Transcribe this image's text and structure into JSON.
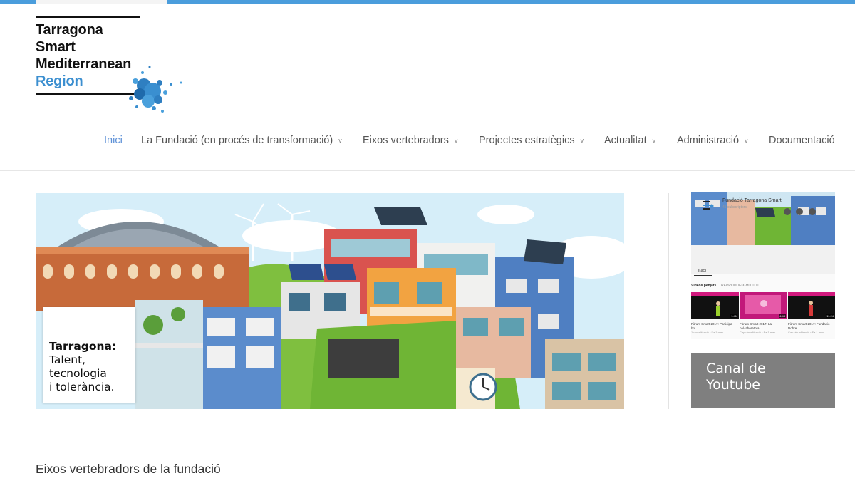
{
  "logo": {
    "lines": [
      "Tarragona",
      "Smart",
      "Mediterranean",
      "Region"
    ]
  },
  "nav": {
    "items": [
      {
        "label": "Inici",
        "active": true,
        "dropdown": false
      },
      {
        "label": "La Fundació (en procés de transformació)",
        "active": false,
        "dropdown": true
      },
      {
        "label": "Eixos vertebradors",
        "active": false,
        "dropdown": true
      },
      {
        "label": "Projectes estratègics",
        "active": false,
        "dropdown": true
      },
      {
        "label": "Actualitat",
        "active": false,
        "dropdown": true
      },
      {
        "label": "Administració",
        "active": false,
        "dropdown": true
      },
      {
        "label": "Documentació",
        "active": false,
        "dropdown": false
      }
    ],
    "chevron": "v",
    "colors": {
      "active": "#5b8fd6",
      "normal": "#555555"
    }
  },
  "hero": {
    "card_title": "Tarragona:",
    "card_lines": [
      "Talent,",
      "tecnologia",
      "i tolerància."
    ]
  },
  "youtube": {
    "channel_name": "Fundació Tarragona Smart",
    "subscribers": "45 subscriptors",
    "tab": "INICI",
    "section_videos": "Vídeos penjats",
    "section_play": "REPRODUEIX-HO TOT",
    "videos": [
      {
        "title": "Fòrum Smart 2017: Participa-ho!",
        "meta": "1 visualització • Fa 1 mes",
        "duration": "1:41"
      },
      {
        "title": "Fòrum Smart 2017: La col·laboratora",
        "meta": "Cap visualització • Fa 1 mes",
        "duration": "4:48"
      },
      {
        "title": "Fòrum Smart 2017: Fundació Dobre",
        "meta": "Cap visualització • Fa 1 mes",
        "duration": "11:24"
      }
    ],
    "button_lines": [
      "Canal de",
      "Youtube"
    ],
    "button_color": "#7f7f7f"
  },
  "section": {
    "title": "Eixos vertebradors de la fundació"
  },
  "colors": {
    "brand_blue": "#3c8fd0",
    "topbar": "#4a9ddc"
  }
}
